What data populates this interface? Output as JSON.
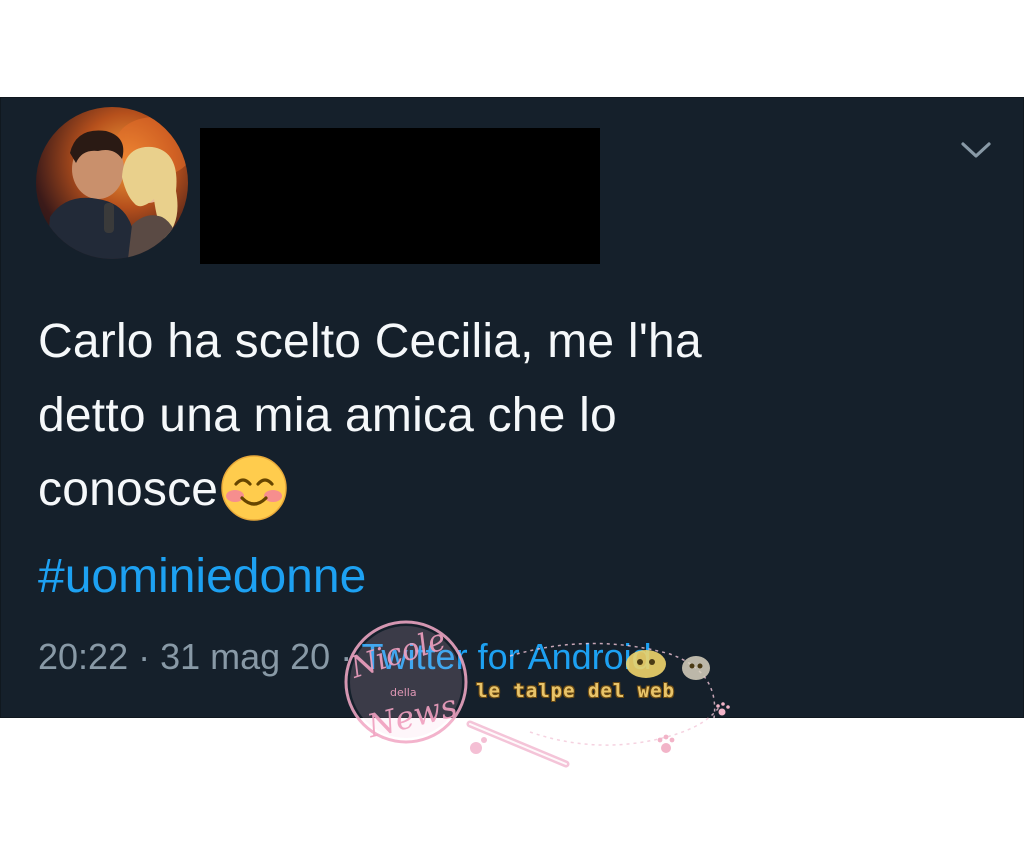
{
  "tweet": {
    "text_lines": [
      "Carlo ha scelto Cecilia, me l'ha",
      "detto una mia amica che lo",
      "conosce"
    ],
    "emoji": "smiling-face-with-smiling-eyes",
    "hashtag": "#uominiedonne",
    "timestamp": "20:22 · 31 mag 20",
    "separator": " · ",
    "source": "Twitter for Android"
  },
  "icons": {
    "chevron": "chevron-down-icon",
    "avatar": "profile-avatar"
  },
  "watermarks": {
    "stamp_text": "Nicole della News",
    "web_label": "le talpe del web"
  },
  "colors": {
    "background": "#15202b",
    "text": "#f5f8fa",
    "link": "#1da1f2",
    "muted": "#8899a6",
    "redaction": "#000000"
  }
}
